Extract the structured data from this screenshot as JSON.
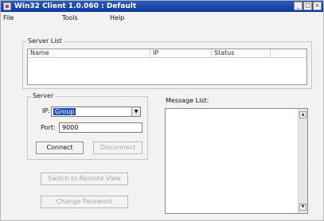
{
  "window": {
    "title": "Win32 Client 1.0.060 : Default",
    "minimize": "_",
    "maximize": "□",
    "close": "×"
  },
  "menu": {
    "file": "File",
    "tools": "Tools",
    "help": "Help"
  },
  "server_list": {
    "legend": "Server List",
    "columns": [
      "Name",
      "IP",
      "Status"
    ]
  },
  "server": {
    "legend": "Server",
    "ip_label": "IP:",
    "ip_value": "Group",
    "port_label": "Port:",
    "port_value": "9000",
    "connect_label": "Connect",
    "disconnect_label": "Disconnect"
  },
  "actions": {
    "switch_remote_view": "Switch to Remote View",
    "change_password": "Change Password"
  },
  "messages": {
    "label": "Message List:"
  }
}
